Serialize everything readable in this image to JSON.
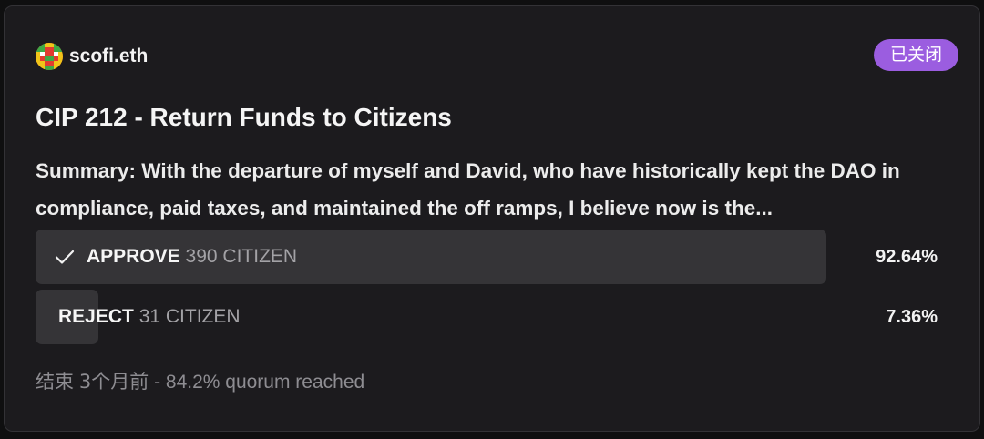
{
  "proposal": {
    "author": "scofi.eth",
    "status_badge": "已关闭",
    "title": "CIP 212 - Return Funds to Citizens",
    "summary": "Summary: With the departure of myself and David, who have historically kept the DAO in compliance, paid taxes, and maintained the off ramps, I believe now is the...",
    "choices": [
      {
        "name": "APPROVE",
        "count": "390 CITIZEN",
        "percent_text": "92.64%",
        "percent": 92.64,
        "selected": true,
        "icon": "check-icon"
      },
      {
        "name": "REJECT",
        "count": "31 CITIZEN",
        "percent_text": "7.36%",
        "percent": 7.36,
        "selected": false
      }
    ],
    "footer": {
      "ended_label": "结束",
      "ended_when": "3个月前",
      "quorum": "- 84.2% quorum reached"
    }
  },
  "colors": {
    "badge": "#9b5de0",
    "bar": "#353437",
    "card": "#1c1b1e"
  }
}
